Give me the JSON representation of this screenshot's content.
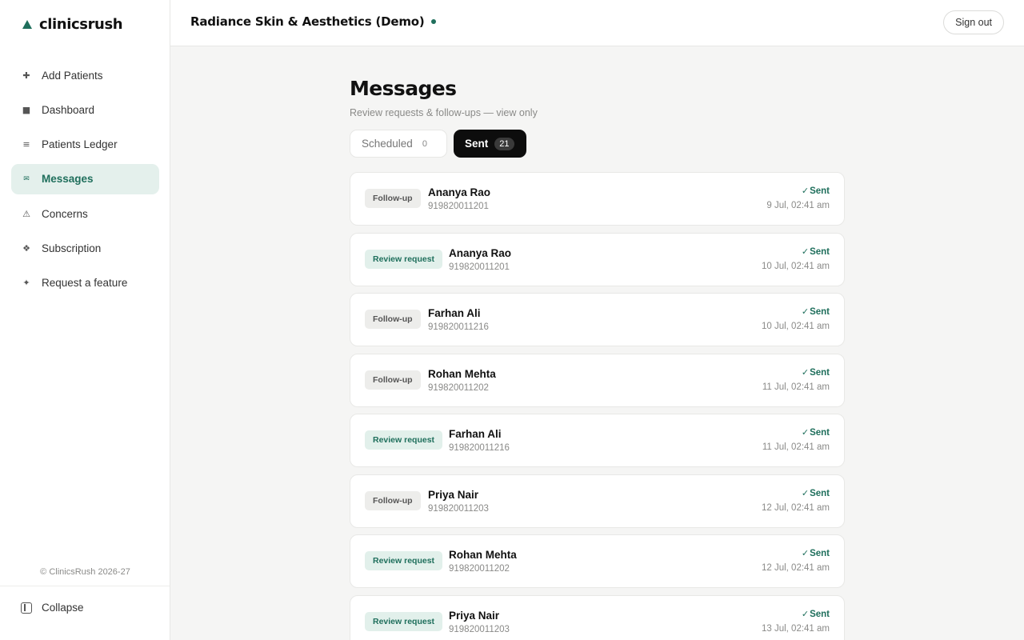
{
  "brand": {
    "name": "clinicsrush"
  },
  "nav": {
    "items": [
      {
        "label": "Add Patients",
        "icon": "✚",
        "icon_name": "plus-icon",
        "active": false
      },
      {
        "label": "Dashboard",
        "icon": "■",
        "icon_name": "dashboard-icon",
        "active": false
      },
      {
        "label": "Patients Ledger",
        "icon": "≡",
        "icon_name": "list-icon",
        "active": false
      },
      {
        "label": "Messages",
        "icon": "✉",
        "icon_name": "mail-icon",
        "active": true
      },
      {
        "label": "Concerns",
        "icon": "⚠",
        "icon_name": "warning-icon",
        "active": false
      },
      {
        "label": "Subscription",
        "icon": "❖",
        "icon_name": "subscription-icon",
        "active": false
      },
      {
        "label": "Request a feature",
        "icon": "✦",
        "icon_name": "sparkle-icon",
        "active": false
      }
    ]
  },
  "footer": {
    "copyright": "© ClinicsRush 2026-27",
    "collapse_label": "Collapse"
  },
  "header": {
    "clinic_name": "Radiance Skin & Aesthetics (Demo)",
    "signout_label": "Sign out"
  },
  "page": {
    "title": "Messages",
    "subtitle": "Review requests & follow-ups — view only",
    "tabs": [
      {
        "label": "Scheduled",
        "count": "0",
        "active": false
      },
      {
        "label": "Sent",
        "count": "21",
        "active": true
      }
    ]
  },
  "messages": [
    {
      "type": "Follow-up",
      "kind": "followup",
      "name": "Ananya Rao",
      "phone": "919820011201",
      "status": "Sent",
      "time": "9 Jul, 02:41 am"
    },
    {
      "type": "Review request",
      "kind": "review",
      "name": "Ananya Rao",
      "phone": "919820011201",
      "status": "Sent",
      "time": "10 Jul, 02:41 am"
    },
    {
      "type": "Follow-up",
      "kind": "followup",
      "name": "Farhan Ali",
      "phone": "919820011216",
      "status": "Sent",
      "time": "10 Jul, 02:41 am"
    },
    {
      "type": "Follow-up",
      "kind": "followup",
      "name": "Rohan Mehta",
      "phone": "919820011202",
      "status": "Sent",
      "time": "11 Jul, 02:41 am"
    },
    {
      "type": "Review request",
      "kind": "review",
      "name": "Farhan Ali",
      "phone": "919820011216",
      "status": "Sent",
      "time": "11 Jul, 02:41 am"
    },
    {
      "type": "Follow-up",
      "kind": "followup",
      "name": "Priya Nair",
      "phone": "919820011203",
      "status": "Sent",
      "time": "12 Jul, 02:41 am"
    },
    {
      "type": "Review request",
      "kind": "review",
      "name": "Rohan Mehta",
      "phone": "919820011202",
      "status": "Sent",
      "time": "12 Jul, 02:41 am"
    },
    {
      "type": "Review request",
      "kind": "review",
      "name": "Priya Nair",
      "phone": "919820011203",
      "status": "Sent",
      "time": "13 Jul, 02:41 am"
    }
  ],
  "colors": {
    "accent": "#1f6f5c",
    "accent_bg": "#e4f0ec",
    "background": "#f5f5f4"
  }
}
